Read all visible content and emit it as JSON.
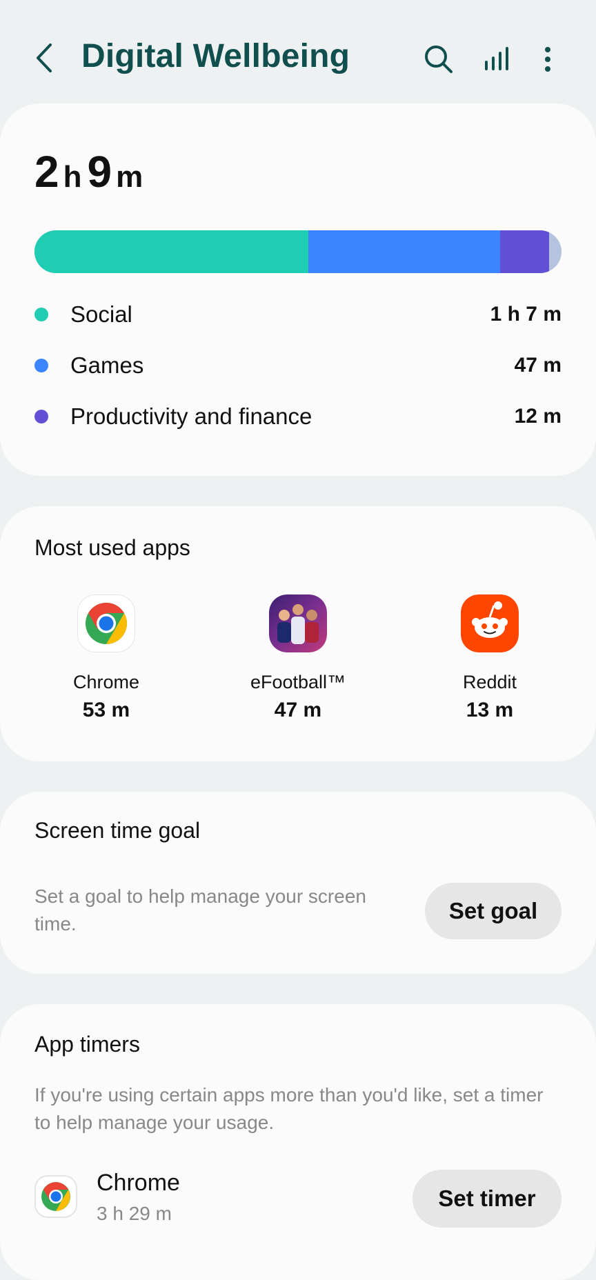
{
  "header": {
    "title": "Digital Wellbeing",
    "icons": [
      "back-icon",
      "search-icon",
      "chart-icon",
      "more-vert-icon"
    ]
  },
  "usage": {
    "total_hours": "2",
    "hours_unit": "h",
    "total_minutes": "9",
    "minutes_unit": "m",
    "categories": [
      {
        "label": "Social",
        "time": "1 h 7 m",
        "color": "#1ecdb2",
        "minutes": 67
      },
      {
        "label": "Games",
        "time": "47 m",
        "color": "#3a84ff",
        "minutes": 47
      },
      {
        "label": "Productivity and finance",
        "time": "12 m",
        "color": "#6150d6",
        "minutes": 12
      }
    ],
    "other_color": "#b4c4df",
    "total_minutes_value": 129
  },
  "most_used": {
    "title": "Most used apps",
    "apps": [
      {
        "name": "Chrome",
        "time": "53 m",
        "icon": "chrome-icon"
      },
      {
        "name": "eFootball™",
        "time": "47 m",
        "icon": "efootball-icon"
      },
      {
        "name": "Reddit",
        "time": "13 m",
        "icon": "reddit-icon"
      }
    ]
  },
  "goal": {
    "title": "Screen time goal",
    "description": "Set a goal to help manage your screen time.",
    "button": "Set goal"
  },
  "timers": {
    "title": "App timers",
    "description": "If you're using certain apps more than you'd like, set a timer to help manage your usage.",
    "app_name": "Chrome",
    "app_time": "3 h 29 m",
    "button": "Set timer"
  }
}
